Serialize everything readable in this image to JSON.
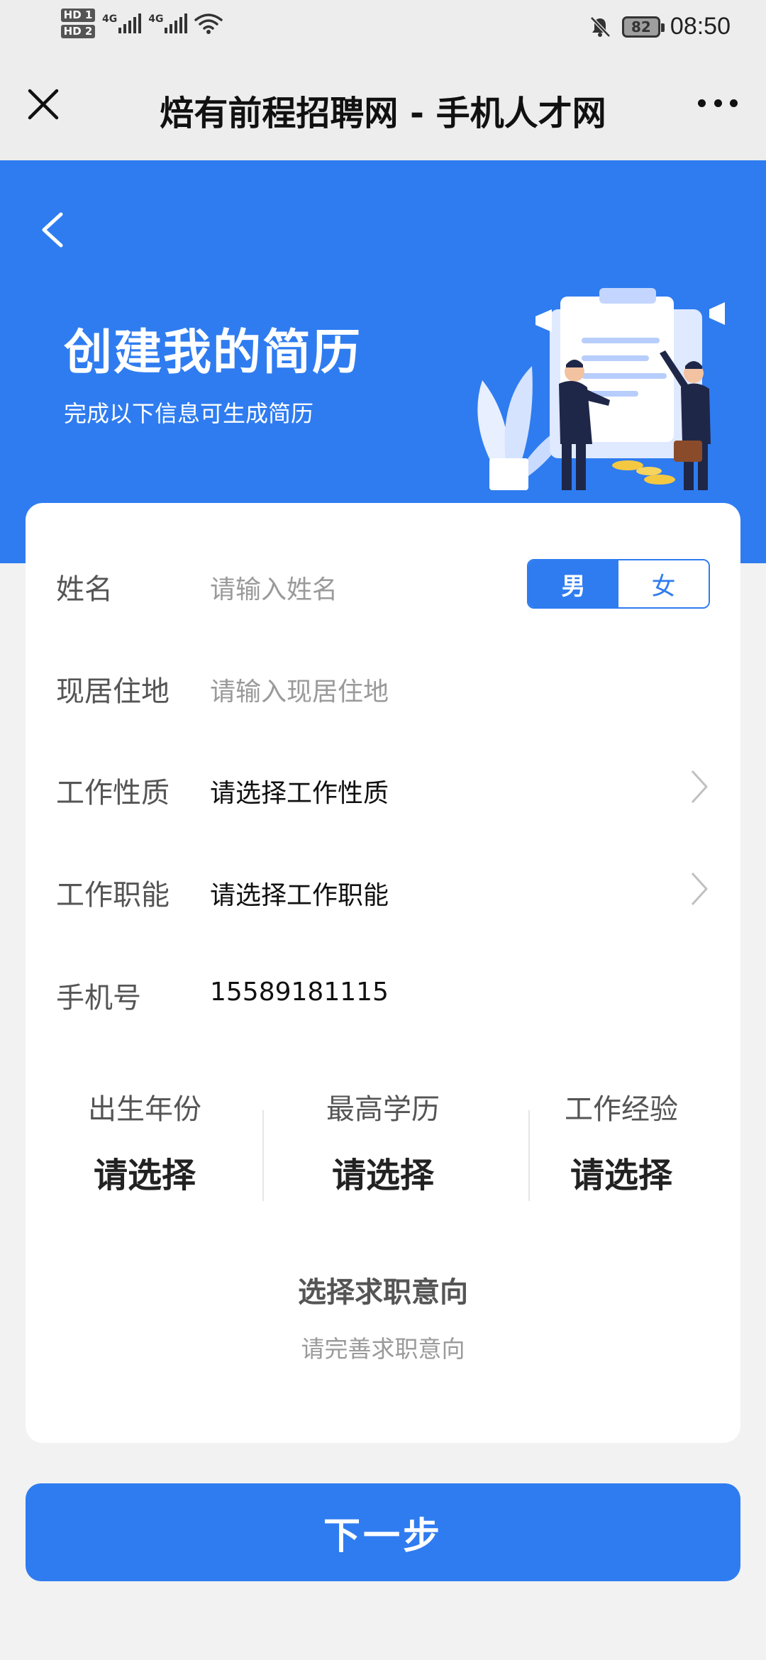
{
  "status_bar": {
    "sim1": "HD 1",
    "sim2": "HD 2",
    "network1": "4G",
    "network2": "4G",
    "battery": "82",
    "time": "08:50"
  },
  "title_bar": {
    "title": "焙有前程招聘网 - 手机人才网"
  },
  "hero": {
    "title": "创建我的简历",
    "subtitle": "完成以下信息可生成简历"
  },
  "form": {
    "name": {
      "label": "姓名",
      "placeholder": "请输入姓名"
    },
    "gender": {
      "male": "男",
      "female": "女",
      "selected": "男"
    },
    "residence": {
      "label": "现居住地",
      "placeholder": "请输入现居住地"
    },
    "job_type": {
      "label": "工作性质",
      "value": "请选择工作性质"
    },
    "job_function": {
      "label": "工作职能",
      "value": "请选择工作职能"
    },
    "phone": {
      "label": "手机号",
      "value": "15589181115"
    },
    "birth_year": {
      "label": "出生年份",
      "value": "请选择"
    },
    "education": {
      "label": "最高学历",
      "value": "请选择"
    },
    "experience": {
      "label": "工作经验",
      "value": "请选择"
    },
    "intent": {
      "title": "选择求职意向",
      "subtitle": "请完善求职意向"
    }
  },
  "next_button": "下一步",
  "colors": {
    "primary": "#2f7cf0",
    "background": "#f2f2f2",
    "topbar": "#ededed"
  }
}
